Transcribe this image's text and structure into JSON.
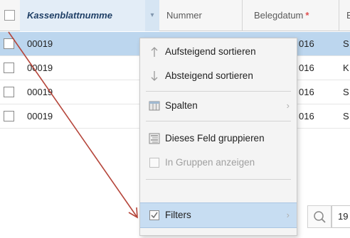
{
  "grid": {
    "columns": [
      {
        "label": "Kassenblattnumme",
        "required": false,
        "active": true
      },
      {
        "label": "Nummer",
        "required": false,
        "active": false
      },
      {
        "label": "Belegdatum",
        "required": true,
        "active": false
      },
      {
        "label": "E",
        "required": false,
        "active": false
      }
    ],
    "required_marker": "*",
    "rows": [
      {
        "kassenblatt": "00019",
        "belegdatum": "016",
        "e": "S",
        "selected": true
      },
      {
        "kassenblatt": "00019",
        "belegdatum": "016",
        "e": "K",
        "selected": false
      },
      {
        "kassenblatt": "00019",
        "belegdatum": "016",
        "e": "S",
        "selected": false
      },
      {
        "kassenblatt": "00019",
        "belegdatum": "016",
        "e": "S",
        "selected": false
      }
    ]
  },
  "column_menu": {
    "items": [
      {
        "label": "Aufsteigend sortieren",
        "icon": "sort-ascending-icon",
        "disabled": false
      },
      {
        "label": "Absteigend sortieren",
        "icon": "sort-descending-icon",
        "disabled": false
      },
      {
        "label": "Spalten",
        "icon": "columns-icon",
        "submenu": true
      },
      {
        "label": "Dieses Feld gruppieren",
        "icon": "group-icon",
        "disabled": false
      },
      {
        "label": "In Gruppen anzeigen",
        "icon": "checkbox-icon",
        "disabled": true
      },
      {
        "label": "Filters",
        "icon": "checkbox-checked-icon",
        "submenu": true,
        "hover": true
      }
    ],
    "submenu_chevron": "›"
  },
  "filter_bar": {
    "search_icon": "search-icon",
    "value": "19"
  },
  "annotation": {
    "arrow_color": "#b5453a"
  },
  "colors": {
    "selected_row": "#bcd6ee",
    "menu_hover": "#c7ddf2",
    "active_header": "#e3edf7"
  }
}
